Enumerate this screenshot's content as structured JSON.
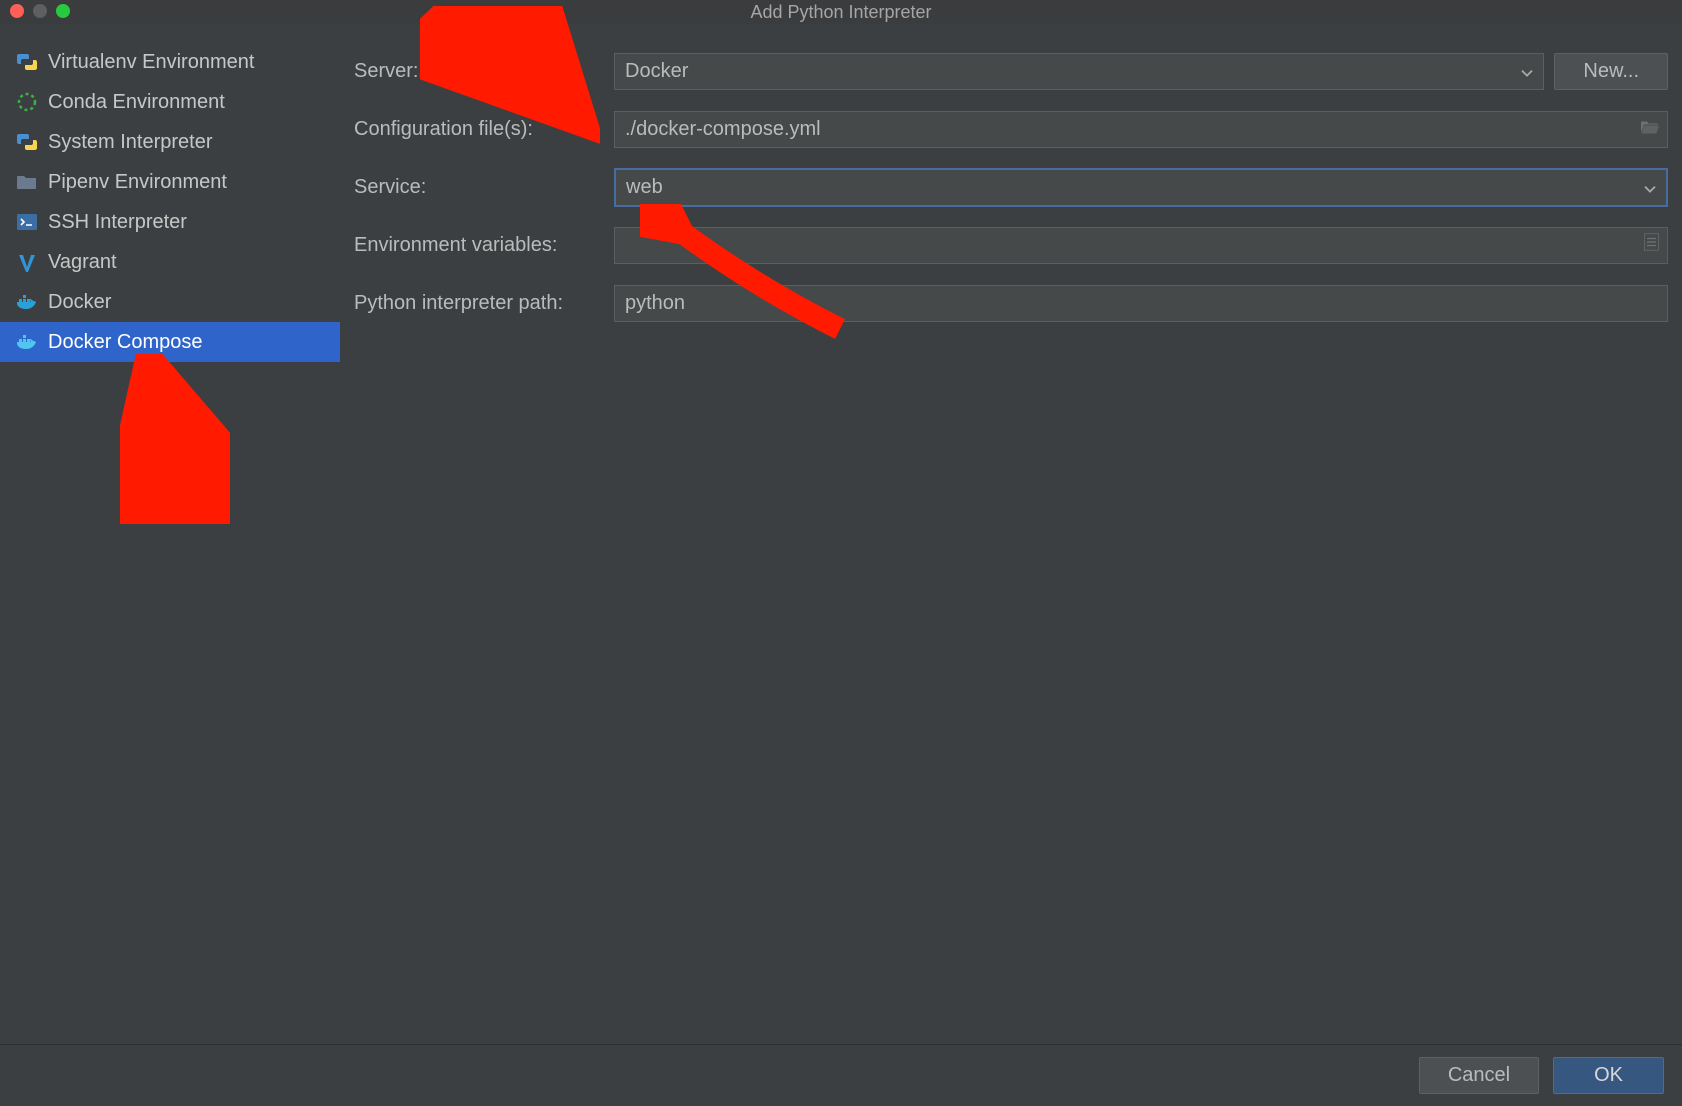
{
  "title": "Add Python Interpreter",
  "sidebar": {
    "items": [
      {
        "label": "Virtualenv Environment"
      },
      {
        "label": "Conda Environment"
      },
      {
        "label": "System Interpreter"
      },
      {
        "label": "Pipenv Environment"
      },
      {
        "label": "SSH Interpreter"
      },
      {
        "label": "Vagrant"
      },
      {
        "label": "Docker"
      },
      {
        "label": "Docker Compose"
      }
    ]
  },
  "form": {
    "server_label": "Server:",
    "server_value": "Docker",
    "new_button": "New...",
    "config_label": "Configuration file(s):",
    "config_value": "./docker-compose.yml",
    "service_label": "Service:",
    "service_value": "web",
    "env_label": "Environment variables:",
    "env_value": "",
    "path_label": "Python interpreter path:",
    "path_value": "python"
  },
  "footer": {
    "cancel": "Cancel",
    "ok": "OK"
  }
}
